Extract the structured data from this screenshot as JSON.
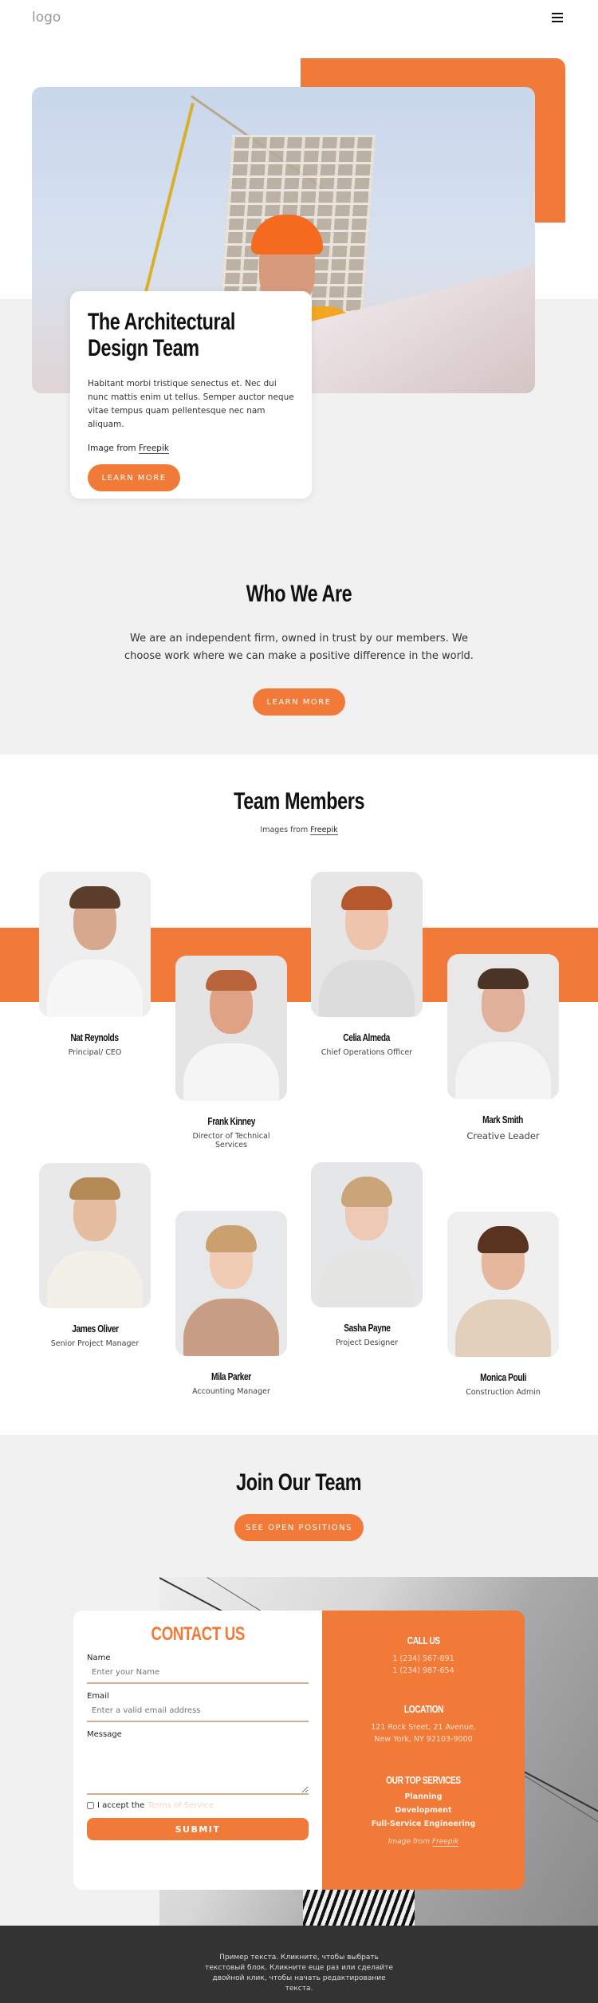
{
  "header": {
    "logo": "logo",
    "menu_icon": "hamburger-menu-icon"
  },
  "hero": {
    "title": "The Architectural Design Team",
    "text": "Habitant morbi tristique senectus et. Nec dui nunc mattis enim ut tellus. Semper auctor neque vitae tempus quam pellentesque nec nam aliquam.",
    "credit_prefix": "Image from",
    "credit_link": "Freepik",
    "button": "LEARN MORE"
  },
  "who": {
    "title": "Who We Are",
    "text": "We are an independent firm, owned in trust by our members. We choose work where we can make a positive difference in the world.",
    "button": "LEARN MORE"
  },
  "team": {
    "title": "Team Members",
    "credit_prefix": "Images from",
    "credit_link": "Freepik",
    "members": [
      {
        "name": "Nat Reynolds",
        "role": "Principal/ CEO"
      },
      {
        "name": "Frank Kinney",
        "role": "Director of Technical Services"
      },
      {
        "name": "Celia Almeda",
        "role": "Chief Operations Officer"
      },
      {
        "name": "Mark Smith",
        "role": "Creative Leader"
      },
      {
        "name": "James Oliver",
        "role": "Senior Project Manager"
      },
      {
        "name": "Mila Parker",
        "role": "Accounting Manager"
      },
      {
        "name": "Sasha Payne",
        "role": "Project Designer"
      },
      {
        "name": "Monica Pouli",
        "role": "Construction Admin"
      }
    ]
  },
  "join": {
    "title": "Join Our Team",
    "button": "SEE OPEN POSITIONS"
  },
  "contact": {
    "title": "CONTACT US",
    "name_label": "Name",
    "name_placeholder": "Enter your Name",
    "email_label": "Email",
    "email_placeholder": "Enter a valid email address",
    "message_label": "Message",
    "terms_prefix": "I accept the",
    "terms_link": "Terms of Service",
    "submit": "SUBMIT"
  },
  "info": {
    "call_title": "CALL US",
    "phones": [
      "1 (234) 567-891",
      "1 (234) 987-654"
    ],
    "location_title": "LOCATION",
    "address": [
      "121 Rock Sreet, 21 Avenue,",
      "New York, NY 92103-9000"
    ],
    "services_title": "OUR TOP SERVICES",
    "services": [
      "Planning",
      "Development",
      "Full-Service Engineering"
    ],
    "credit_prefix": "Image from",
    "credit_link": "Freepik"
  },
  "footer": {
    "text": "Пример текста. Кликните, чтобы выбрать текстовый блок. Кликните еще раз или сделайте двойной клик, чтобы начать редактирование текста."
  },
  "colors": {
    "accent": "#f27a38",
    "section_gray": "#f1f1f1",
    "footer_bg": "#333333"
  }
}
